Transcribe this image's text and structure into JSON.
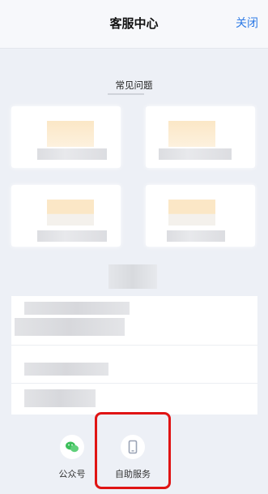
{
  "header": {
    "title": "客服中心",
    "close_label": "关闭"
  },
  "faq": {
    "section_title": "常见问题"
  },
  "services": [
    {
      "label": "公众号",
      "icon": "wechat-icon"
    },
    {
      "label": "自助服务",
      "icon": "phone-icon"
    }
  ],
  "colors": {
    "accent": "#2f7be6",
    "highlight": "#e01414",
    "background": "#edf0f6"
  }
}
